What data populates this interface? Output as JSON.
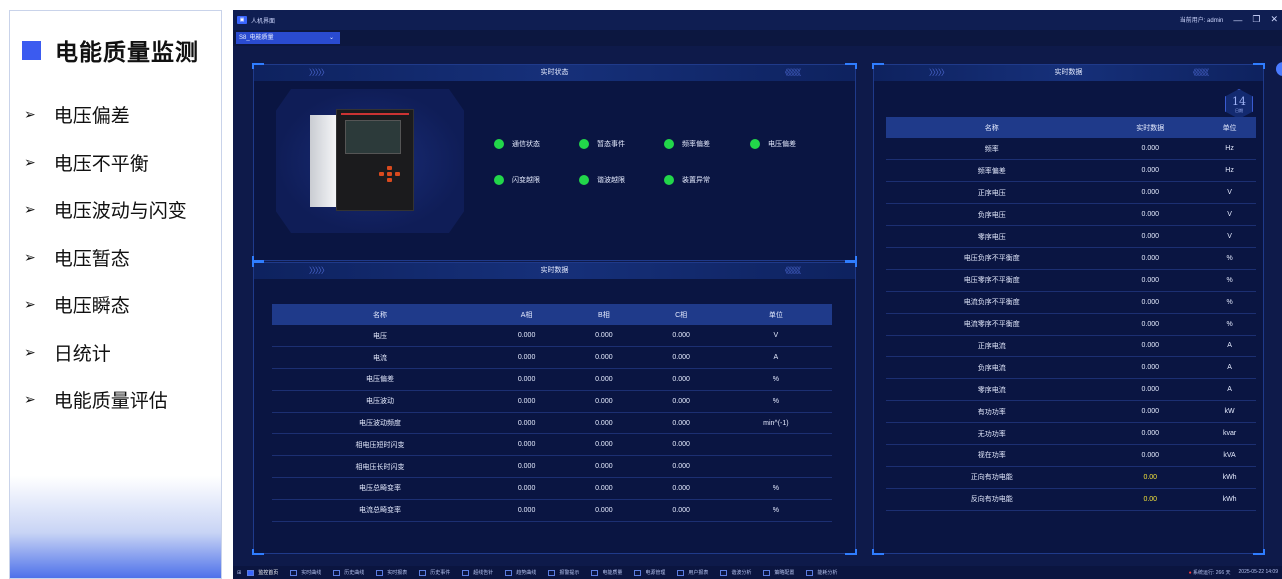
{
  "left_panel": {
    "title": "电能质量监测",
    "items": [
      "电压偏差",
      "电压不平衡",
      "电压波动与闪变",
      "电压暂态",
      "电压瞬态",
      "日统计",
      "电能质量评估"
    ]
  },
  "window": {
    "title": "人机界面",
    "user_label": "当前用户: admin",
    "minimize": "—",
    "maximize": "❐",
    "close": "✕"
  },
  "selector": {
    "value": "S8_电能质量",
    "chevron": "⌄"
  },
  "status_panel": {
    "title": "实时状态",
    "chev_left": "〉〉〉〉〉",
    "chev_right": "《《《《《",
    "items": [
      "通信状态",
      "暂态事件",
      "频率偏差",
      "电压偏差",
      "闪变越限",
      "谐波越限",
      "装置异常"
    ]
  },
  "phase_panel": {
    "title": "实时数据",
    "chev_left": "〉〉〉〉〉",
    "chev_right": "《《《《《",
    "columns": [
      "名称",
      "A相",
      "B相",
      "C相",
      "单位"
    ],
    "rows": [
      [
        "电压",
        "0.000",
        "0.000",
        "0.000",
        "V"
      ],
      [
        "电流",
        "0.000",
        "0.000",
        "0.000",
        "A"
      ],
      [
        "电压偏差",
        "0.000",
        "0.000",
        "0.000",
        "%"
      ],
      [
        "电压波动",
        "0.000",
        "0.000",
        "0.000",
        "%"
      ],
      [
        "电压波动频度",
        "0.000",
        "0.000",
        "0.000",
        "min^(-1)"
      ],
      [
        "相电压短时闪变",
        "0.000",
        "0.000",
        "0.000",
        ""
      ],
      [
        "相电压长时闪变",
        "0.000",
        "0.000",
        "0.000",
        ""
      ],
      [
        "电压总畸变率",
        "0.000",
        "0.000",
        "0.000",
        "%"
      ],
      [
        "电流总畸变率",
        "0.000",
        "0.000",
        "0.000",
        "%"
      ]
    ]
  },
  "data_panel": {
    "title": "实时数据",
    "chev_left": "〉〉〉〉〉",
    "chev_right": "《《《《《",
    "badge_num": "14",
    "badge_sub": "日期",
    "columns": [
      "名称",
      "实时数据",
      "单位"
    ],
    "rows": [
      [
        "频率",
        "0.000",
        "Hz"
      ],
      [
        "频率偏差",
        "0.000",
        "Hz"
      ],
      [
        "正序电压",
        "0.000",
        "V"
      ],
      [
        "负序电压",
        "0.000",
        "V"
      ],
      [
        "零序电压",
        "0.000",
        "V"
      ],
      [
        "电压负序不平衡度",
        "0.000",
        "%"
      ],
      [
        "电压零序不平衡度",
        "0.000",
        "%"
      ],
      [
        "电流负序不平衡度",
        "0.000",
        "%"
      ],
      [
        "电流零序不平衡度",
        "0.000",
        "%"
      ],
      [
        "正序电流",
        "0.000",
        "A"
      ],
      [
        "负序电流",
        "0.000",
        "A"
      ],
      [
        "零序电流",
        "0.000",
        "A"
      ],
      [
        "有功功率",
        "0.000",
        "kW"
      ],
      [
        "无功功率",
        "0.000",
        "kvar"
      ],
      [
        "视在功率",
        "0.000",
        "kVA"
      ],
      [
        "正向有功电能",
        "0.00",
        "kWh"
      ],
      [
        "反向有功电能",
        "0.00",
        "kWh"
      ]
    ]
  },
  "taskbar": {
    "items": [
      "监控首页",
      "实时曲线",
      "历史曲线",
      "实时报表",
      "历史事件",
      "超线告针",
      "趋势曲线",
      "报警提示",
      "电能质量",
      "电源管理",
      "用户报表",
      "谐波分析",
      "策略配置",
      "能耗分析"
    ],
    "status": "系统运行: 266 天",
    "datetime": "2025-05-22 14:09"
  }
}
